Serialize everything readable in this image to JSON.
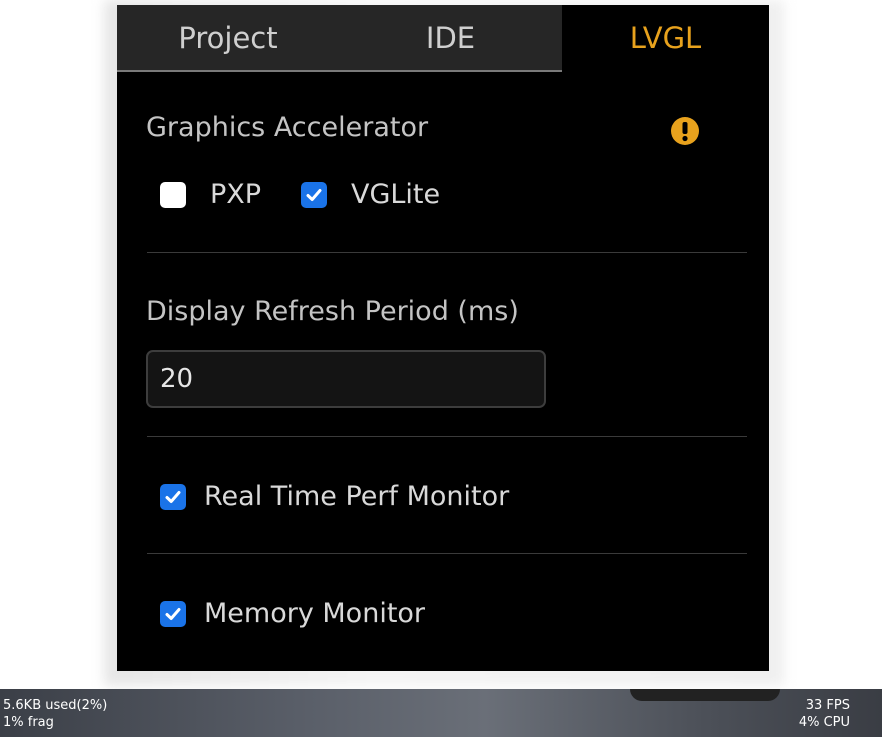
{
  "tabs": [
    {
      "label": "Project",
      "active": false
    },
    {
      "label": "IDE",
      "active": false
    },
    {
      "label": "LVGL",
      "active": true
    }
  ],
  "colors": {
    "accent": "#e8a21d",
    "checkbox_checked": "#1a73e8",
    "panel_bg": "#000000",
    "inactive_tab_bg": "#262626"
  },
  "graphics_accelerator": {
    "label": "Graphics Accelerator",
    "warning_icon": "exclamation-circle-icon",
    "options": [
      {
        "label": "PXP",
        "checked": false
      },
      {
        "label": "VGLite",
        "checked": true
      }
    ]
  },
  "display_refresh": {
    "label": "Display Refresh Period  (ms)",
    "value": "20"
  },
  "perf_monitor": {
    "label": "Real Time Perf Monitor",
    "checked": true
  },
  "memory_monitor": {
    "label": "Memory Monitor",
    "checked": true
  },
  "status_bar": {
    "memory_used": "5.6KB used(2%)",
    "fragmentation": "1% frag",
    "fps": "33 FPS",
    "cpu": "4% CPU"
  }
}
